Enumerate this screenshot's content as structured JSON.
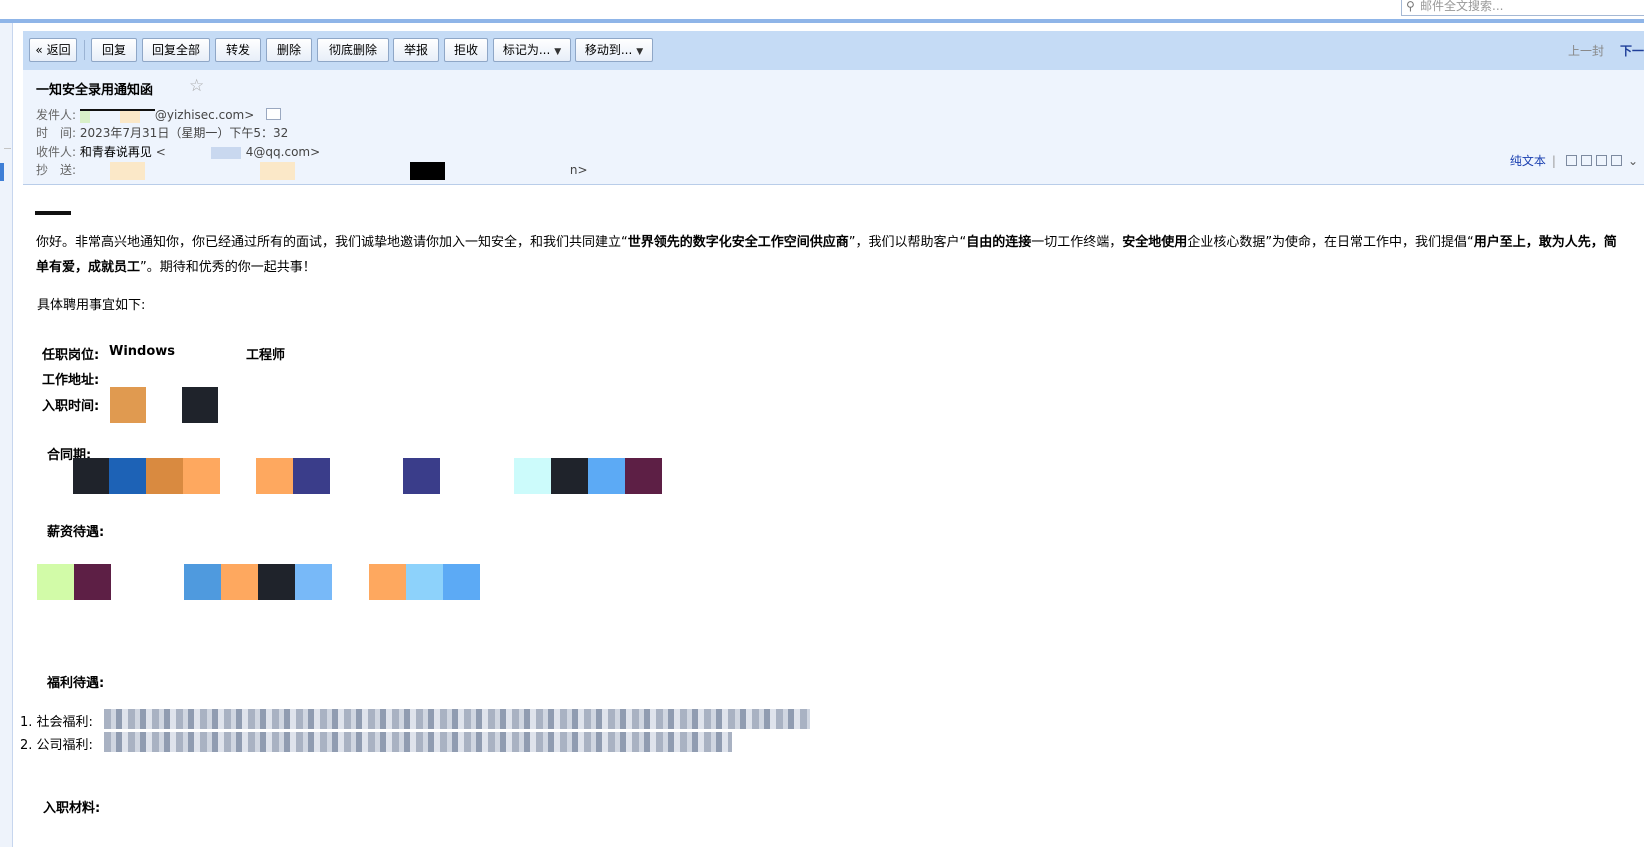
{
  "search": {
    "placeholder": "邮件全文搜索..."
  },
  "toolbar": {
    "back": "« 返回",
    "reply": "回复",
    "reply_all": "回复全部",
    "forward": "转发",
    "delete": "删除",
    "delete_forever": "彻底删除",
    "report": "举报",
    "reject": "拒收",
    "mark_as": "标记为...",
    "move_to": "移动到...",
    "prev": "上一封",
    "next": "下一封"
  },
  "header": {
    "subject": "一知安全录用通知函",
    "star": "☆",
    "from_label": "发件人:",
    "from_value": "@yizhisec.com>",
    "time_label": "时　间:",
    "time_value": "2023年7月31日（星期一）下午5：32",
    "to_label": "收件人:",
    "to_name": "和青春说再见",
    "to_prefix": "<",
    "to_value": "4@qq.com>",
    "cc_label": "抄　送:",
    "cc_value": "n>",
    "plain_text": "纯文本"
  },
  "body": {
    "greeting_hello": "你好",
    "intro_1": "。非常高兴地通知你，你已经通过所有的面试，我们诚挚地邀请你加入一知安全，和我们共同建立“",
    "intro_b1": "世界领先的数字化安全工作空间供应商",
    "intro_2": "”，我们以帮助客户“",
    "intro_b2": "自由的连接",
    "intro_3": "一切工作终端，",
    "intro_b3": "安全地使用",
    "intro_4": "企业核心数据”为使命，在日常工作中，我们提倡“",
    "intro_b4": "用户至上，敢为人先，简单有爱，成就员工",
    "intro_5": "”。期待和优秀的你一起共事！",
    "details_title": "具体聘用事宜如下:",
    "position_label": "任职岗位:",
    "position_value_1": "Windows",
    "position_value_2": "工程师",
    "location_label": "工作地址:",
    "start_label": "入职时间:",
    "contract_label": "合同期:",
    "salary_label": "薪资待遇:",
    "benefits_label": "福利待遇:",
    "benefit_1": "1. 社会福利:",
    "benefit_2": "2. 公司福利:",
    "materials_label": "入职材料:"
  },
  "colors": {
    "toolbar_bg": "#c5dbf5",
    "header_bg": "#eef4fd",
    "link": "#1a3fb0"
  }
}
